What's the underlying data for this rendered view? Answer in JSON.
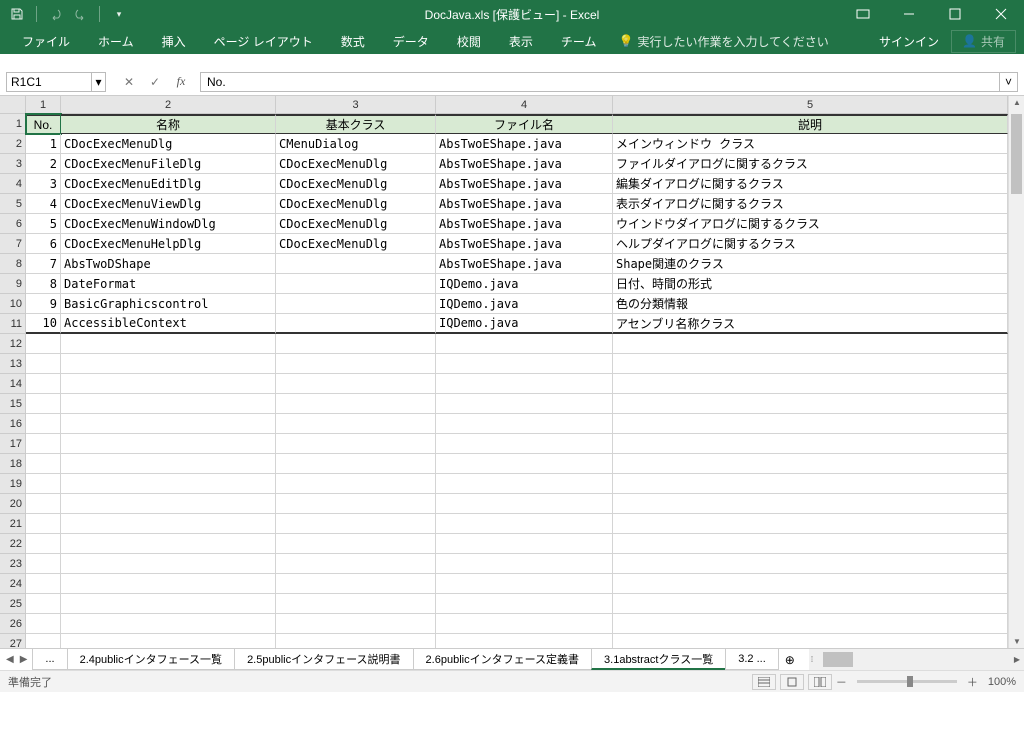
{
  "title": "DocJava.xls  [保護ビュー] - Excel",
  "ribbon": {
    "file": "ファイル",
    "home": "ホーム",
    "insert": "挿入",
    "pagelayout": "ページ レイアウト",
    "formulas": "数式",
    "data": "データ",
    "review": "校閲",
    "view": "表示",
    "team": "チーム",
    "tell": "実行したい作業を入力してください",
    "signin": "サインイン",
    "share": "共有"
  },
  "namebox": "R1C1",
  "formula": "No.",
  "colheads": [
    "1",
    "2",
    "3",
    "4",
    "5"
  ],
  "rowheads": [
    "1",
    "2",
    "3",
    "4",
    "5",
    "6",
    "7",
    "8",
    "9",
    "10",
    "11",
    "12",
    "13",
    "14",
    "15",
    "16",
    "17",
    "18",
    "19",
    "20",
    "21",
    "22",
    "23",
    "24",
    "25",
    "26",
    "27"
  ],
  "headers": {
    "no": "No.",
    "name": "名称",
    "base": "基本クラス",
    "file": "ファイル名",
    "desc": "説明"
  },
  "rows": [
    {
      "n": "1",
      "name": "CDocExecMenuDlg",
      "base": "CMenuDialog",
      "file": "AbsTwoEShape.java",
      "desc": "メインウィンドウ クラス"
    },
    {
      "n": "2",
      "name": "CDocExecMenuFileDlg",
      "base": "CDocExecMenuDlg",
      "file": "AbsTwoEShape.java",
      "desc": "ファイルダイアログに関するクラス"
    },
    {
      "n": "3",
      "name": "CDocExecMenuEditDlg",
      "base": "CDocExecMenuDlg",
      "file": "AbsTwoEShape.java",
      "desc": "編集ダイアログに関するクラス"
    },
    {
      "n": "4",
      "name": "CDocExecMenuViewDlg",
      "base": "CDocExecMenuDlg",
      "file": "AbsTwoEShape.java",
      "desc": "表示ダイアログに関するクラス"
    },
    {
      "n": "5",
      "name": "CDocExecMenuWindowDlg",
      "base": "CDocExecMenuDlg",
      "file": "AbsTwoEShape.java",
      "desc": "ウインドウダイアログに関するクラス"
    },
    {
      "n": "6",
      "name": "CDocExecMenuHelpDlg",
      "base": "CDocExecMenuDlg",
      "file": "AbsTwoEShape.java",
      "desc": "ヘルプダイアログに関するクラス"
    },
    {
      "n": "7",
      "name": "AbsTwoDShape",
      "base": "",
      "file": "AbsTwoEShape.java",
      "desc": "Shape関連のクラス"
    },
    {
      "n": "8",
      "name": "DateFormat",
      "base": "",
      "file": "IQDemo.java",
      "desc": "日付、時間の形式"
    },
    {
      "n": "9",
      "name": "BasicGraphicscontrol",
      "base": "",
      "file": "IQDemo.java",
      "desc": "色の分類情報"
    },
    {
      "n": "10",
      "name": "AccessibleContext",
      "base": "",
      "file": "IQDemo.java",
      "desc": "アセンブリ名称クラス"
    }
  ],
  "tabs": {
    "ellipsis": "...",
    "t1": "2.4publicインタフェース一覧",
    "t2": "2.5publicインタフェース説明書",
    "t3": "2.6publicインタフェース定義書",
    "active": "3.1abstractクラス一覧",
    "t5": "3.2 ..."
  },
  "status": {
    "ready": "準備完了",
    "zoom": "100%"
  }
}
